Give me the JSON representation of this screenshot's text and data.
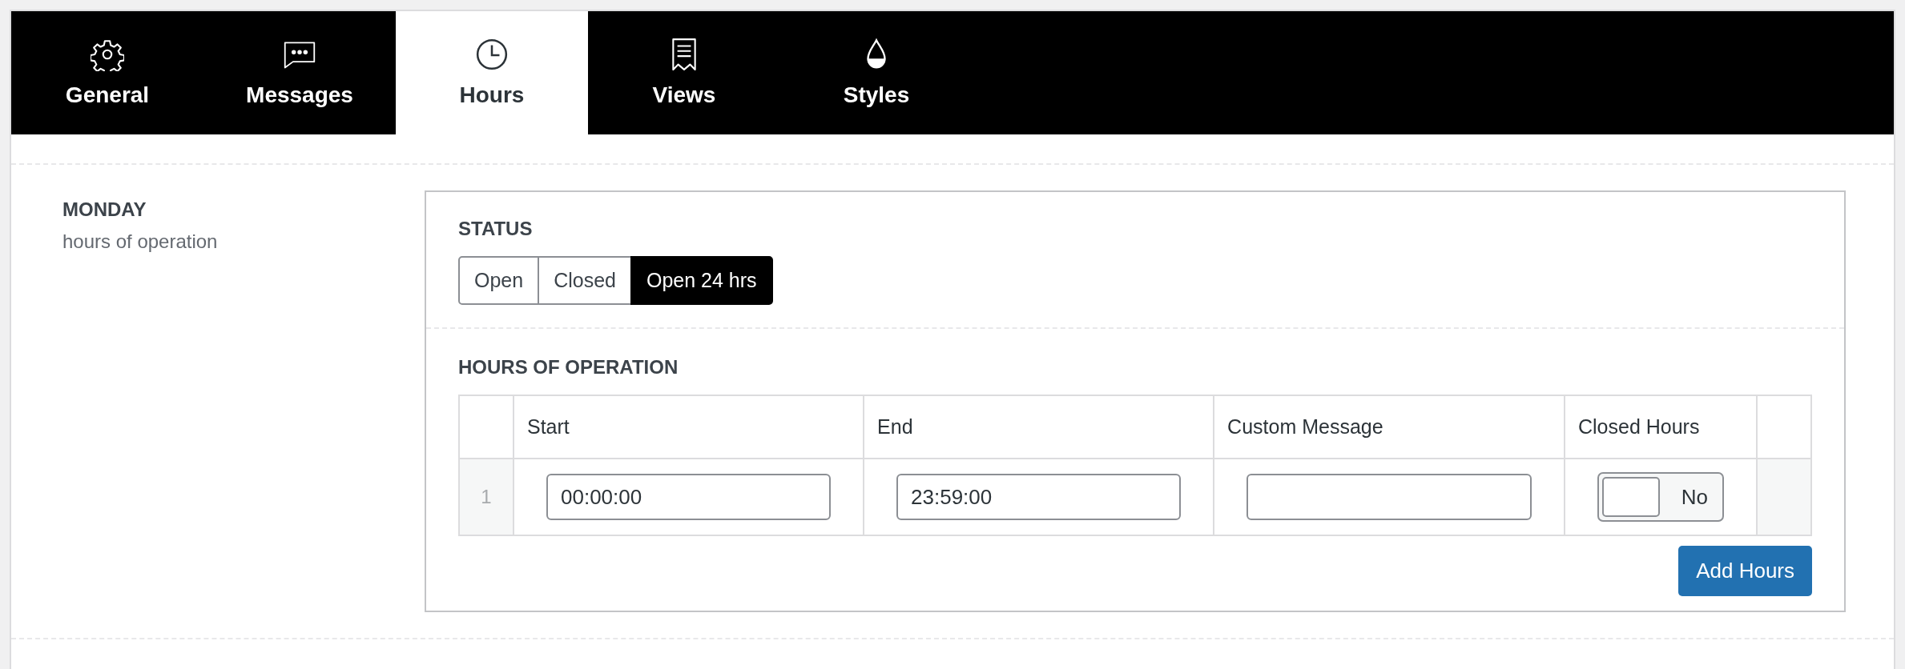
{
  "tabs": [
    {
      "label": "General",
      "selected": false
    },
    {
      "label": "Messages",
      "selected": false
    },
    {
      "label": "Hours",
      "selected": true
    },
    {
      "label": "Views",
      "selected": false
    },
    {
      "label": "Styles",
      "selected": false
    }
  ],
  "day": {
    "title": "MONDAY",
    "subtitle": "hours of operation"
  },
  "status": {
    "heading": "STATUS",
    "options": [
      {
        "label": "Open",
        "selected": false
      },
      {
        "label": "Closed",
        "selected": false
      },
      {
        "label": "Open 24 hrs",
        "selected": true
      }
    ]
  },
  "hours": {
    "heading": "HOURS OF OPERATION",
    "columns": [
      "Start",
      "End",
      "Custom Message",
      "Closed Hours"
    ],
    "rows": [
      {
        "index": "1",
        "start": "00:00:00",
        "end": "23:59:00",
        "closed_hours": {
          "label": "No",
          "on": false
        }
      }
    ]
  },
  "add_button": "Add Hours"
}
